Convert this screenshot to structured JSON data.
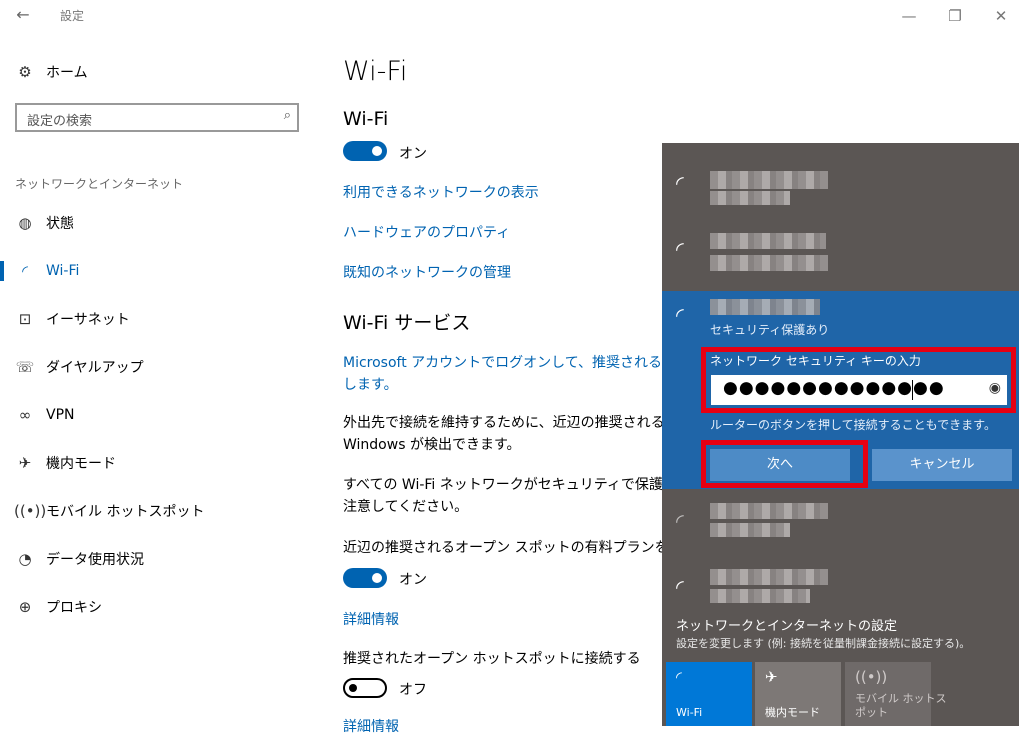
{
  "window": {
    "title": "設定",
    "back_glyph": "←",
    "minimize": "—",
    "restore": "❐",
    "close": "✕"
  },
  "nav": {
    "home": "ホーム",
    "search_placeholder": "設定の検索",
    "section": "ネットワークとインターネット",
    "items": [
      {
        "label": "状態",
        "icon": "globe-icon"
      },
      {
        "label": "Wi-Fi",
        "icon": "wifi-icon"
      },
      {
        "label": "イーサネット",
        "icon": "ethernet-icon"
      },
      {
        "label": "ダイヤルアップ",
        "icon": "dialup-icon"
      },
      {
        "label": "VPN",
        "icon": "vpn-icon"
      },
      {
        "label": "機内モード",
        "icon": "airplane-icon"
      },
      {
        "label": "モバイル ホットスポット",
        "icon": "hotspot-icon"
      },
      {
        "label": "データ使用状況",
        "icon": "data-usage-icon"
      },
      {
        "label": "プロキシ",
        "icon": "proxy-icon"
      }
    ]
  },
  "main": {
    "title": "Wi-Fi",
    "wifi_heading": "Wi-Fi",
    "wifi_toggle": "オン",
    "links": [
      "利用できるネットワークの表示",
      "ハードウェアのプロパティ",
      "既知のネットワークの管理"
    ],
    "services_heading": "Wi-Fi サービス",
    "ms_link_1": "Microsoft アカウントでログオンして、推奨されるオープン",
    "ms_link_2": "します。",
    "para1_1": "外出先で接続を維持するために、近辺の推奨されるオー",
    "para1_2": "Windows が検出できます。",
    "para2_1": "すべての Wi-Fi ネットワークがセキュリティで保護されてい",
    "para2_2": "注意してください。",
    "paid_label": "近辺の推奨されるオープン スポットの有料プランを探す",
    "paid_toggle": "オン",
    "detail_link": "詳細情報",
    "connect_label": "推奨されたオープン ホットスポットに接続する",
    "connect_toggle": "オフ",
    "detail_link2": "詳細情報"
  },
  "flyout": {
    "secured": "セキュリティ保護あり",
    "key_label": "ネットワーク セキュリティ キーの入力",
    "password_mask": "●●●●●●●●●●●●●●",
    "hint": "ルーターのボタンを押して接続することもできます。",
    "next": "次へ",
    "cancel": "キャンセル",
    "settings_title": "ネットワークとインターネットの設定",
    "settings_sub": "設定を変更します (例: 接続を従量制課金接続に設定する)。",
    "tiles": [
      {
        "label": "Wi-Fi",
        "active": true
      },
      {
        "label": "機内モード",
        "active": false
      },
      {
        "label": "モバイル ホットス\nポット",
        "active": false
      }
    ]
  },
  "colors": {
    "accent": "#0063b1",
    "flyout_bg": "#5b5654",
    "selected_bg": "#1f65a8",
    "highlight": "#e60012"
  }
}
